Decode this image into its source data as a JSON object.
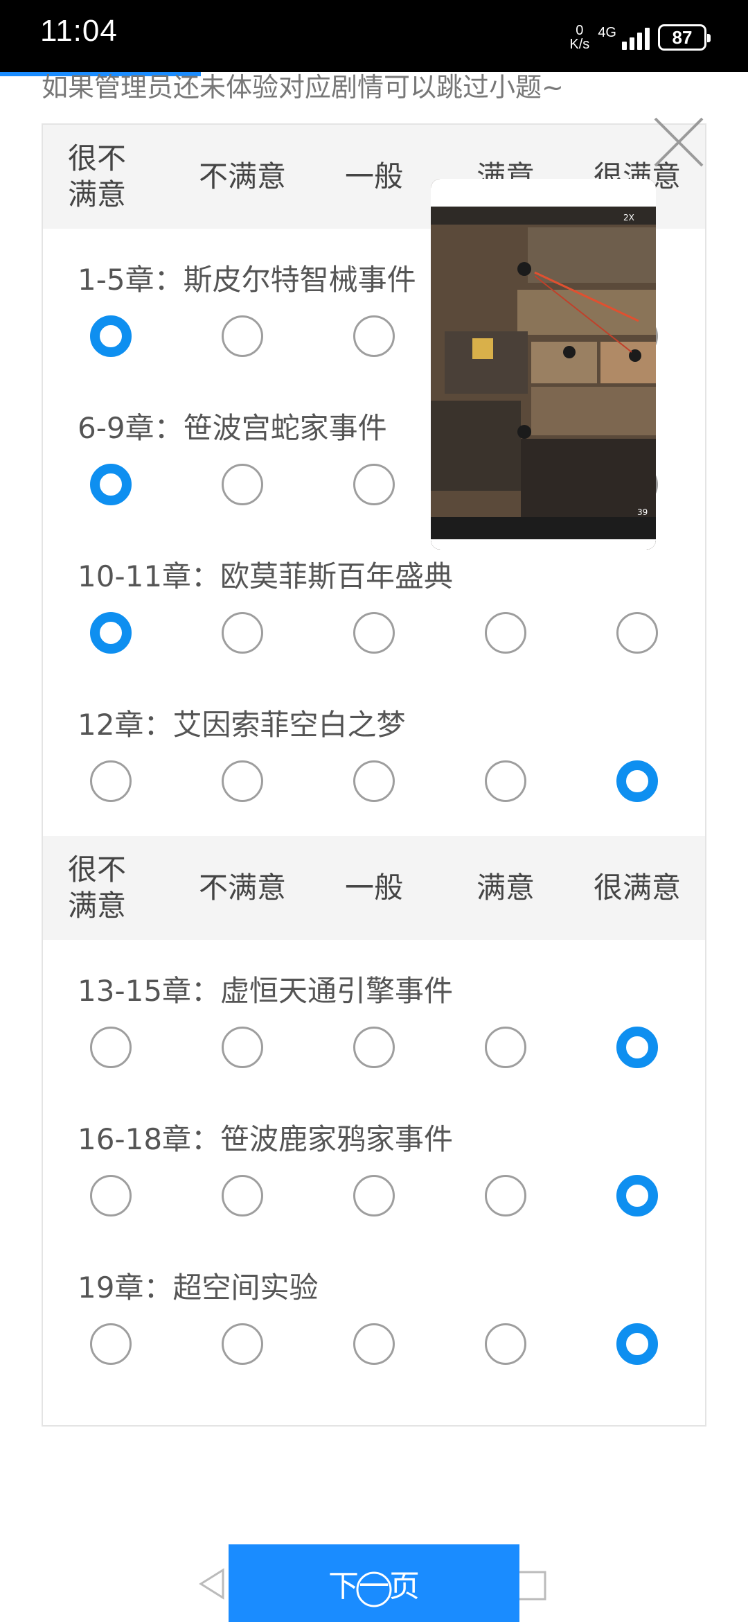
{
  "status_bar": {
    "time": "11:04",
    "net_speed_value": "0",
    "net_speed_unit": "K/s",
    "network": "4G",
    "battery": "87"
  },
  "intro_text": "如果管理员还未体验对应剧情可以跳过小题~",
  "options": [
    "很不满意",
    "不满意",
    "一般",
    "满意",
    "很满意"
  ],
  "groups": [
    {
      "questions": [
        {
          "label": "1-5章：斯皮尔特智械事件",
          "selected": 0
        },
        {
          "label": "6-9章：笹波宫蛇家事件",
          "selected": 0
        },
        {
          "label": "10-11章：欧莫菲斯百年盛典",
          "selected": 0
        },
        {
          "label": "12章：艾因索菲空白之梦",
          "selected": 4
        }
      ]
    },
    {
      "questions": [
        {
          "label": "13-15章：虚恒天通引擎事件",
          "selected": 4
        },
        {
          "label": "16-18章：笹波鹿家鸦家事件",
          "selected": 4
        },
        {
          "label": "19章：超空间实验",
          "selected": 4
        }
      ]
    }
  ],
  "next_button": "下一页",
  "pip_overlay": {
    "multiplier": "2X",
    "counter": "39"
  },
  "colors": {
    "accent": "#0e8ff0",
    "header_bg": "#f4f4f4",
    "status_bar": "#000000"
  }
}
